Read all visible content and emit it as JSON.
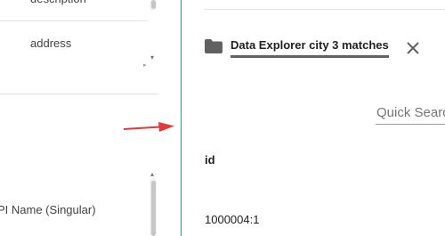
{
  "left_panel": {
    "top_partial_text": "description",
    "field_address_label": "address",
    "field_api_name_label": "PI Name (Singular)"
  },
  "right_panel": {
    "tab_label": "Data Explorer city 3 matches",
    "tab_icon": "folder-icon",
    "close_icon": "close-icon",
    "search_placeholder": "Quick Search",
    "table": {
      "headers": [
        "id"
      ],
      "rows": [
        [
          "1000004:1"
        ]
      ]
    }
  },
  "annotation": {
    "arrow_color": "#e53935"
  },
  "colors": {
    "divider": "#26a69a",
    "tab_underline": "#616161"
  }
}
